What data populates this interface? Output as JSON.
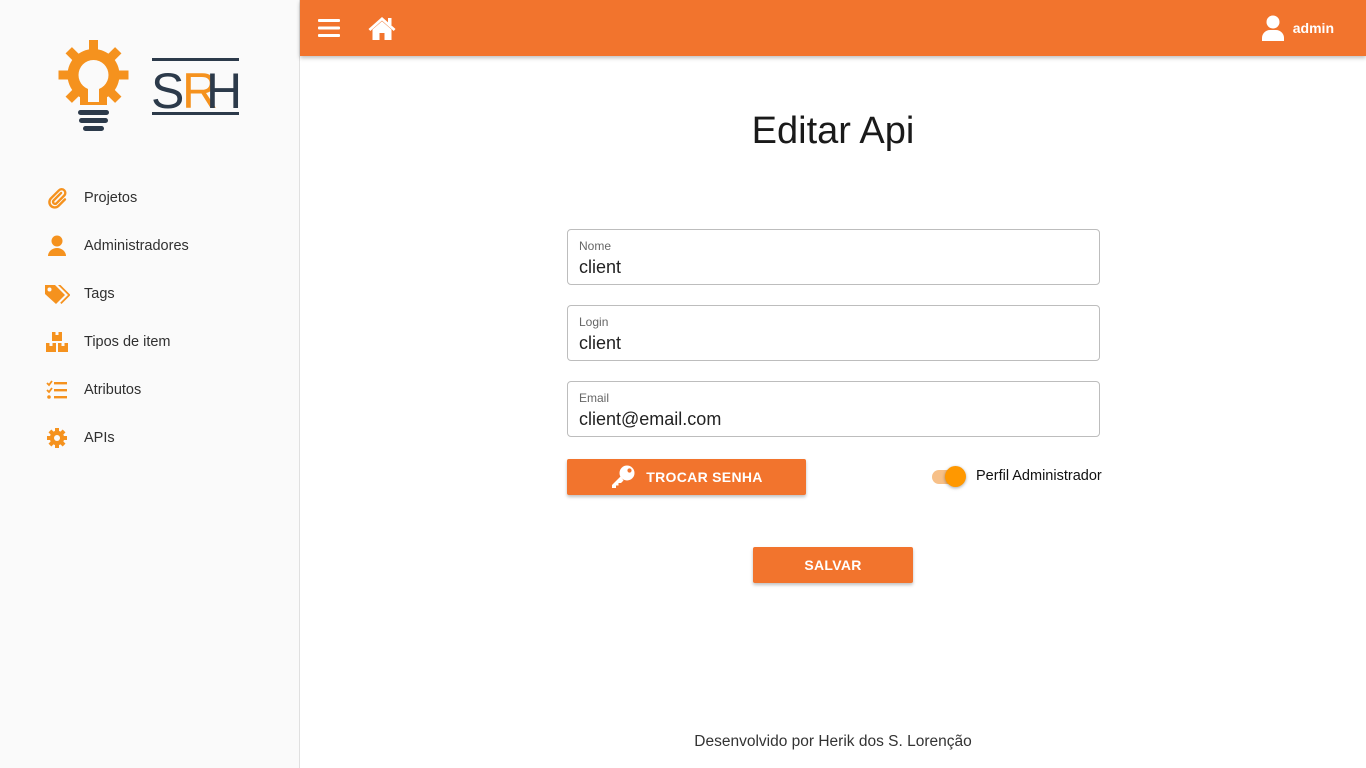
{
  "logo": {
    "text_s": "S",
    "text_r": "R",
    "text_h": "H"
  },
  "colors": {
    "accent": "#f2742d",
    "icon_orange": "#f5921e",
    "logo_dark": "#2c3a4a",
    "toggle": "#ff9800"
  },
  "sidebar": {
    "items": [
      {
        "label": "Projetos",
        "icon": "paperclip-icon"
      },
      {
        "label": "Administradores",
        "icon": "user-icon"
      },
      {
        "label": "Tags",
        "icon": "tags-icon"
      },
      {
        "label": "Tipos de item",
        "icon": "boxes-icon"
      },
      {
        "label": "Atributos",
        "icon": "checklist-icon"
      },
      {
        "label": "APIs",
        "icon": "gear-icon"
      }
    ]
  },
  "header": {
    "user_label": "admin"
  },
  "main": {
    "title": "Editar Api",
    "fields": [
      {
        "label": "Nome",
        "value": "client"
      },
      {
        "label": "Login",
        "value": "client"
      },
      {
        "label": "Email",
        "value": "client@email.com"
      }
    ],
    "change_password_label": "TROCAR SENHA",
    "admin_toggle": {
      "label": "Perfil Administrador",
      "checked": true
    },
    "save_label": "SALVAR"
  },
  "footer": {
    "text": "Desenvolvido por Herik dos S. Lorenção"
  }
}
